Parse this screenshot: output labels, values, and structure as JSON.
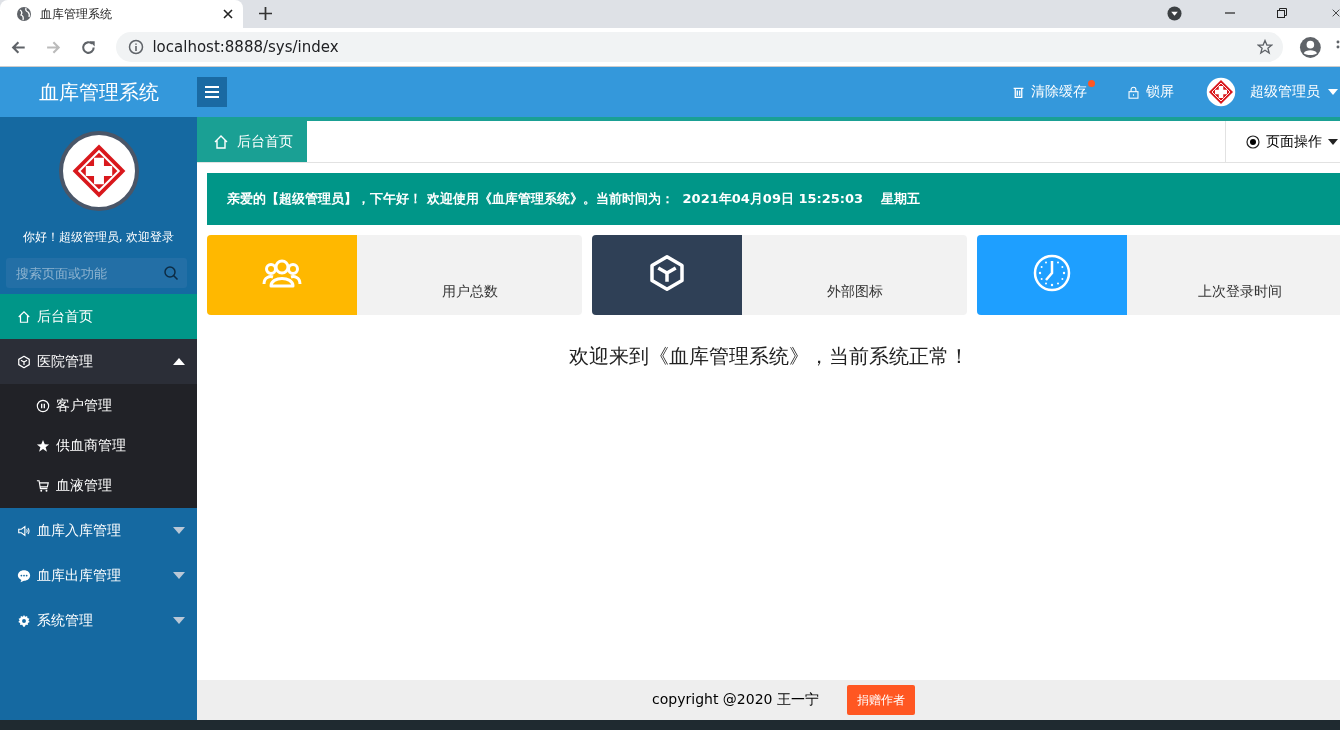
{
  "browser": {
    "tab_title": "血库管理系统",
    "url": "localhost:8888/sys/index"
  },
  "header": {
    "title": "血库管理系统",
    "actions": [
      {
        "label": "清除缓存",
        "kind": "trash",
        "badge": true
      },
      {
        "label": "锁屏",
        "kind": "lock",
        "badge": false
      }
    ],
    "user": "超级管理员"
  },
  "sidebar": {
    "greeting": "你好！超级管理员, 欢迎登录",
    "search": {
      "placeholder": "搜索页面或功能"
    },
    "items": [
      {
        "label": "后台首页",
        "kind": "home",
        "selected": true
      },
      {
        "label": "医院管理",
        "kind": "cube",
        "selected": false,
        "expanded": true,
        "children": [
          {
            "label": "客户管理",
            "kind": "pause",
            "selected": false
          },
          {
            "label": "供血商管理",
            "kind": "star",
            "selected": false
          },
          {
            "label": "血液管理",
            "kind": "cart",
            "selected": false
          }
        ]
      },
      {
        "label": "血库入库管理",
        "kind": "speaker",
        "selected": false,
        "expanded": false
      },
      {
        "label": "血库出库管理",
        "kind": "chat",
        "selected": false,
        "expanded": false
      },
      {
        "label": "系统管理",
        "kind": "gear",
        "selected": false,
        "expanded": false
      }
    ]
  },
  "tabs": [
    {
      "label": "后台首页",
      "selected": true
    }
  ],
  "page_ops": "页面操作",
  "notice": "亲爱的【超级管理员】，下午好！ 欢迎使用《血库管理系统》。当前时间为：  2021年04月09日 15:25:03    星期五",
  "cards": [
    {
      "label": "用户总数",
      "kind": "users",
      "color": "#ffb800"
    },
    {
      "label": "外部图标",
      "kind": "cube",
      "color": "#2f4056"
    },
    {
      "label": "上次登录时间",
      "kind": "clock",
      "color": "#1e9fff"
    }
  ],
  "welcome": "欢迎来到《血库管理系统》，当前系统正常！",
  "footer": {
    "copyright": "copyright @2020 王一宁",
    "button": "捐赠作者"
  }
}
